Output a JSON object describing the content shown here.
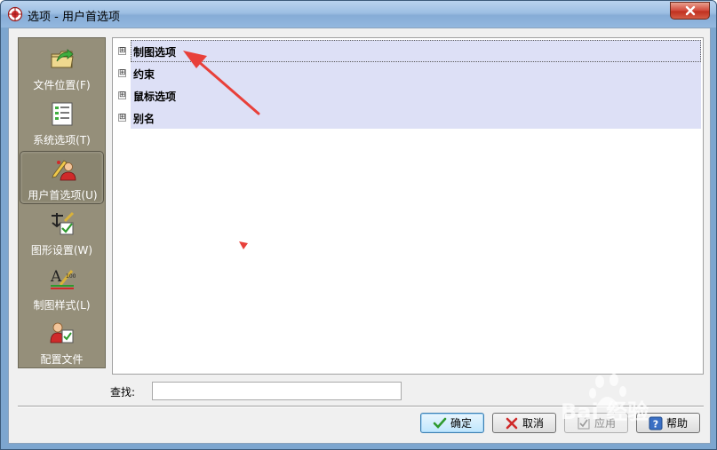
{
  "window": {
    "title": "选项 - 用户首选项",
    "close_icon": "close-icon"
  },
  "nav": {
    "items": [
      {
        "label": "文件位置(F)",
        "icon": "folder-arrow-icon"
      },
      {
        "label": "系统选项(T)",
        "icon": "checklist-icon"
      },
      {
        "label": "用户首选项(U)",
        "icon": "user-pencil-icon",
        "selected": true
      },
      {
        "label": "图形设置(W)",
        "icon": "graphics-settings-icon"
      },
      {
        "label": "制图样式(L)",
        "icon": "drawing-style-icon"
      },
      {
        "label": "配置文件",
        "icon": "user-profile-icon"
      }
    ]
  },
  "tree": {
    "items": [
      {
        "label": "制图选项",
        "expander": "⊞",
        "focused": true
      },
      {
        "label": "约束",
        "expander": "⊞"
      },
      {
        "label": "鼠标选项",
        "expander": "⊞"
      },
      {
        "label": "别名",
        "expander": "⊞"
      }
    ]
  },
  "find": {
    "label": "查找:",
    "value": ""
  },
  "buttons": {
    "ok": "确定",
    "cancel": "取消",
    "apply": "应用",
    "help": "帮助"
  },
  "watermark": {
    "text": "Bai 经验"
  },
  "colors": {
    "nav_bg": "#958f7a",
    "tree_highlight": "#dde0f6",
    "arrow": "#e8403a"
  }
}
